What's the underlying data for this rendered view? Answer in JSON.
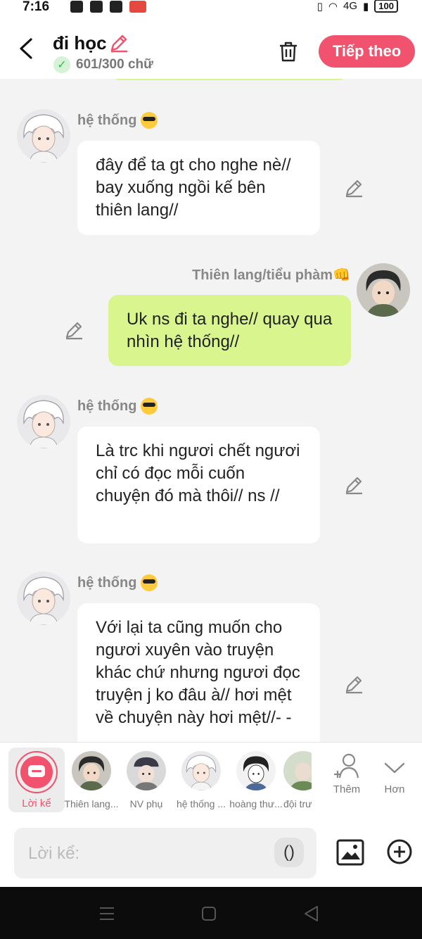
{
  "status_bar": {
    "time": "7:16",
    "network": "4G",
    "battery": "100"
  },
  "header": {
    "title": "đi học",
    "word_count": "601/300 chữ",
    "next_label": "Tiếp theo"
  },
  "messages": [
    {
      "speaker": "hệ thống",
      "text": "đây để ta gt cho nghe nè// bay xuống ngồi kế bên thiên lang//",
      "side": "left"
    },
    {
      "speaker": "Thiên lang/tiểu phàm👊",
      "text": "Uk ns đi ta nghe// quay qua nhìn hệ thống//",
      "side": "right"
    },
    {
      "speaker": "hệ thống",
      "text": "Là trc khi ngươi chết ngươi chỉ có đọc mỗi cuốn chuyện đó mà thôi// ns //",
      "side": "left"
    },
    {
      "speaker": "hệ thống",
      "text": "Với lại ta cũng muốn cho ngươi xuyên vào truyện khác chứ nhưng ngươi đọc truyện j ko đâu à// hơi mệt về chuyện này hơi mệt//- -",
      "side": "left"
    }
  ],
  "characters": {
    "selected": "Lời kể",
    "items": [
      "Thiên lang...",
      "NV phụ",
      "hệ thống ...",
      "hoàng thư...",
      "đội trư"
    ],
    "add_label": "Thêm",
    "more_label": "Hơn"
  },
  "composer": {
    "placeholder": "Lời kể:",
    "paren_label": "()"
  },
  "colors": {
    "accent": "#f1536e",
    "my_bubble": "#d8f58e",
    "background": "#f3f3f3"
  }
}
